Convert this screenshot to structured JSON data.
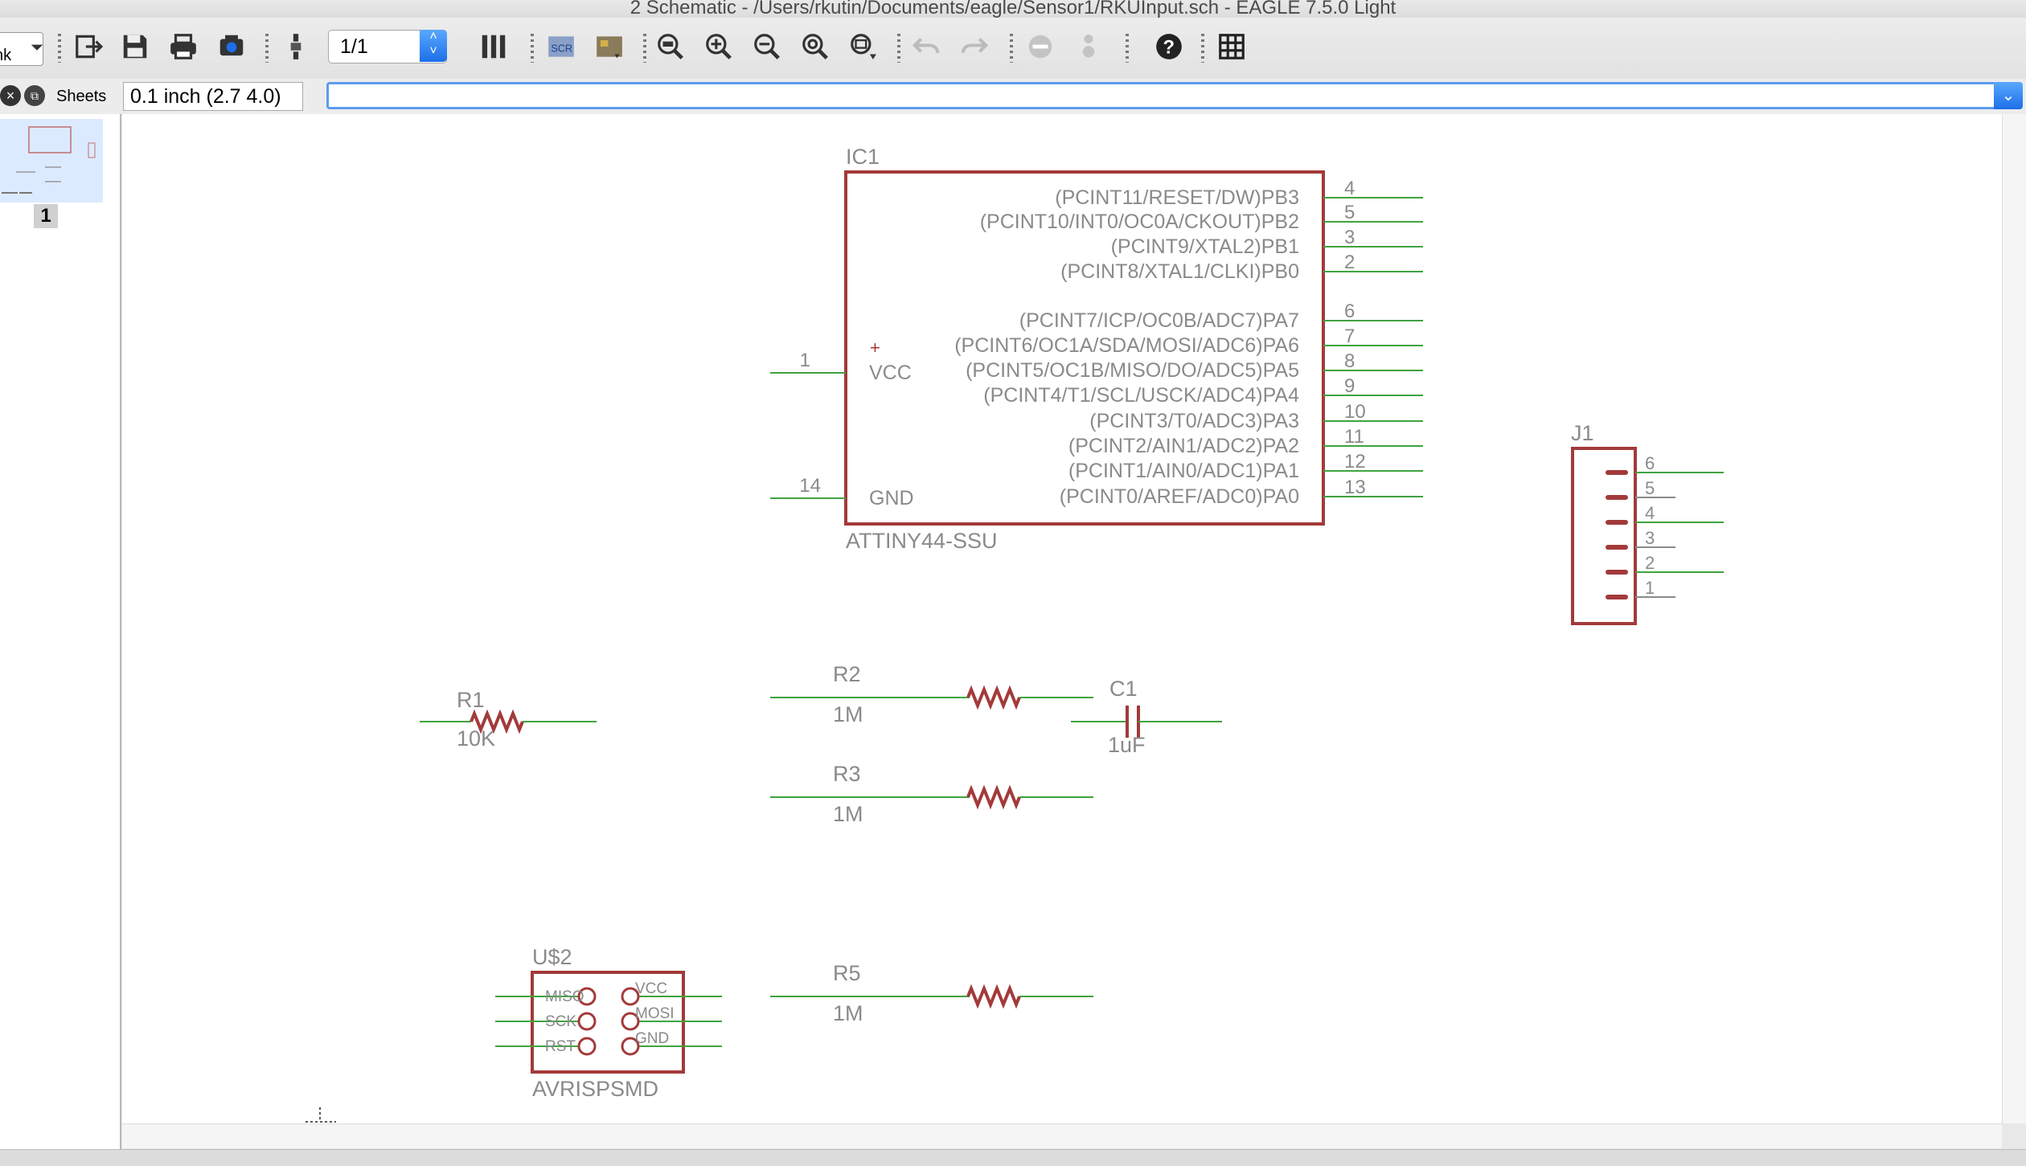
{
  "window": {
    "title": "2 Schematic - /Users/rkutin/Documents/eagle/Sensor1/RKUInput.sch - EAGLE 7.5.0 Light"
  },
  "toolbar": {
    "zoom_combo_value": "nk",
    "sheet_select_value": "1/1"
  },
  "cmdbar": {
    "sheets_label": "Sheets",
    "grid_info": "0.1 inch (2.7 4.0)",
    "command_value": ""
  },
  "sheets_panel": {
    "items": [
      {
        "label": "1"
      }
    ]
  },
  "colors": {
    "symbol": "#a33a3a",
    "wire": "#3fa33f",
    "text": "#8a8a8a",
    "accent": "#1c6fe8"
  },
  "schematic": {
    "ic1": {
      "name": "IC1",
      "value": "ATTINY44-SSU",
      "left_pins": [
        {
          "num": "1",
          "label": "VCC",
          "marker": "+"
        },
        {
          "num": "14",
          "label": "GND"
        }
      ],
      "right_pins": [
        {
          "num": "4",
          "label": "(PCINT11/RESET/DW)PB3"
        },
        {
          "num": "5",
          "label": "(PCINT10/INT0/OC0A/CKOUT)PB2"
        },
        {
          "num": "3",
          "label": "(PCINT9/XTAL2)PB1"
        },
        {
          "num": "2",
          "label": "(PCINT8/XTAL1/CLKI)PB0"
        },
        {
          "num": "6",
          "label": "(PCINT7/ICP/OC0B/ADC7)PA7"
        },
        {
          "num": "7",
          "label": "(PCINT6/OC1A/SDA/MOSI/ADC6)PA6"
        },
        {
          "num": "8",
          "label": "(PCINT5/OC1B/MISO/DO/ADC5)PA5"
        },
        {
          "num": "9",
          "label": "(PCINT4/T1/SCL/USCK/ADC4)PA4"
        },
        {
          "num": "10",
          "label": "(PCINT3/T0/ADC3)PA3"
        },
        {
          "num": "11",
          "label": "(PCINT2/AIN1/ADC2)PA2"
        },
        {
          "num": "12",
          "label": "(PCINT1/AIN0/ADC1)PA1"
        },
        {
          "num": "13",
          "label": "(PCINT0/AREF/ADC0)PA0"
        }
      ]
    },
    "j1": {
      "name": "J1",
      "pins": [
        "6",
        "5",
        "4",
        "3",
        "2",
        "1"
      ]
    },
    "r1": {
      "name": "R1",
      "value": "10K"
    },
    "r2": {
      "name": "R2",
      "value": "1M"
    },
    "r3": {
      "name": "R3",
      "value": "1M"
    },
    "r5": {
      "name": "R5",
      "value": "1M"
    },
    "c1": {
      "name": "C1",
      "value": "1uF"
    },
    "u2": {
      "name": "U$2",
      "value": "AVRISPSMD",
      "left_pins": [
        "MISO",
        "SCK",
        "RST"
      ],
      "right_pins": [
        "VCC",
        "MOSI",
        "GND"
      ]
    }
  }
}
